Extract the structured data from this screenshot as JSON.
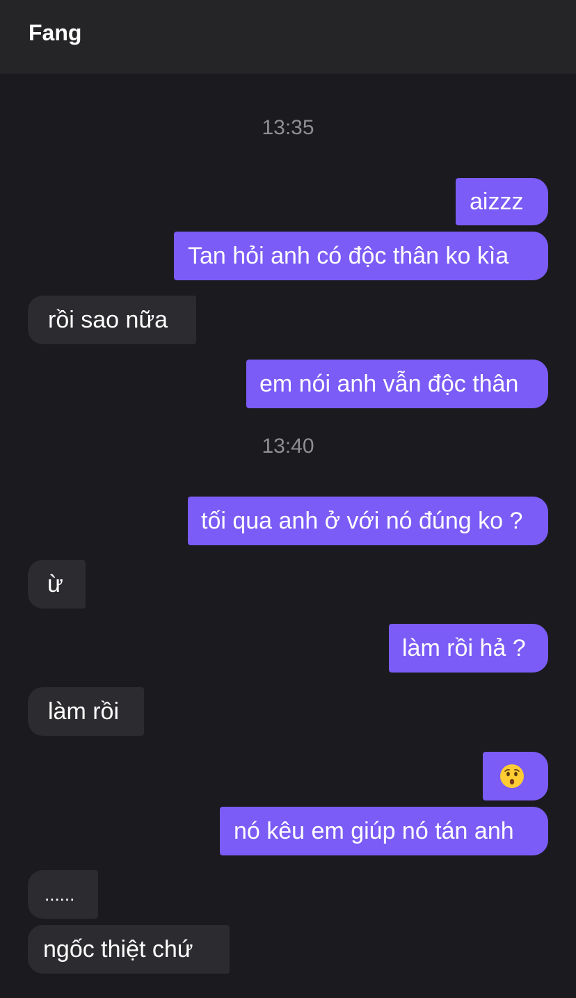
{
  "header": {
    "contact_name": "Fang"
  },
  "timestamps": [
    "13:35",
    "13:40"
  ],
  "messages": [
    {
      "side": "out",
      "text": "aizzz"
    },
    {
      "side": "out",
      "text": "Tan hỏi anh có độc thân ko kìa"
    },
    {
      "side": "in",
      "text": "rồi sao nữa"
    },
    {
      "side": "out",
      "text": "em nói anh vẫn độc thân"
    },
    {
      "side": "out",
      "text": "tối qua anh ở với nó đúng ko ?"
    },
    {
      "side": "in",
      "text": "ừ"
    },
    {
      "side": "out",
      "text": "làm rồi hả ?"
    },
    {
      "side": "in",
      "text": "làm rồi"
    },
    {
      "side": "out",
      "text": "",
      "icon": "hushed-face-emoji-icon"
    },
    {
      "side": "out",
      "text": "nó kêu em giúp nó tán anh"
    },
    {
      "side": "in",
      "text": "......"
    },
    {
      "side": "in",
      "text": "ngốc thiệt chứ"
    }
  ],
  "colors": {
    "background": "#1b1b1f",
    "header": "#252528",
    "outgoing_bubble": "#7b5cf6",
    "incoming_bubble": "#2c2c30",
    "timestamp_text": "#8e8e93"
  }
}
